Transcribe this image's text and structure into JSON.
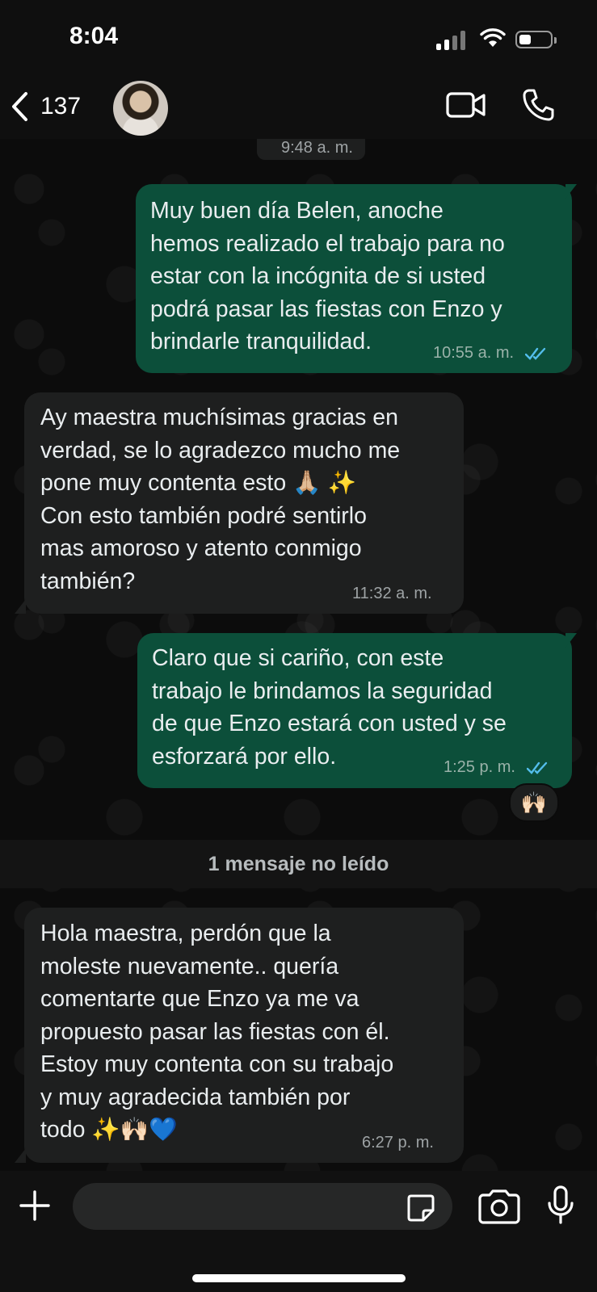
{
  "status_bar": {
    "time": "8:04"
  },
  "header": {
    "back_count": "137",
    "contact_name": ""
  },
  "top_timestamp": "9:48 a. m.",
  "messages": [
    {
      "direction": "out",
      "text": "Muy buen día Belen, anoche\nhemos realizado el trabajo para no\nestar con la incógnita de si usted\npodrá pasar las fiestas con Enzo y\nbrindarle tranquilidad.",
      "time": "10:55 a. m.",
      "status": "read"
    },
    {
      "direction": "in",
      "text": "Ay maestra muchísimas gracias en\nverdad, se lo agradezco mucho me\npone muy contenta esto 🙏🏼 ✨\nCon esto también podré sentirlo\nmas amoroso y atento conmigo\ntambién?",
      "time": "11:32 a. m."
    },
    {
      "direction": "out",
      "text": "Claro que si cariño, con este\ntrabajo le brindamos la seguridad\nde que Enzo estará con usted y se\nesforzará por ello.",
      "time": "1:25 p. m.",
      "status": "read",
      "reaction": "🙌🏻"
    },
    {
      "direction": "in",
      "text": "Hola maestra, perdón que la\nmoleste nuevamente.. quería\ncomentarte que Enzo ya me va\npropuesto pasar las fiestas con él.\nEstoy muy contenta con su trabajo\ny muy agradecida también por\ntodo ✨🙌🏻💙",
      "time": "6:27 p. m."
    }
  ],
  "unread_label": "1 mensaje no leído",
  "composer": {
    "placeholder": ""
  },
  "colors": {
    "outgoing_bubble": "#0c4f3a",
    "incoming_bubble": "#1e1f1f",
    "read_tick": "#53bdeb",
    "background": "#0b0b0b"
  },
  "icons": [
    "back-chevron-icon",
    "video-call-icon",
    "phone-icon",
    "plus-icon",
    "sticker-icon",
    "camera-icon",
    "microphone-icon"
  ]
}
